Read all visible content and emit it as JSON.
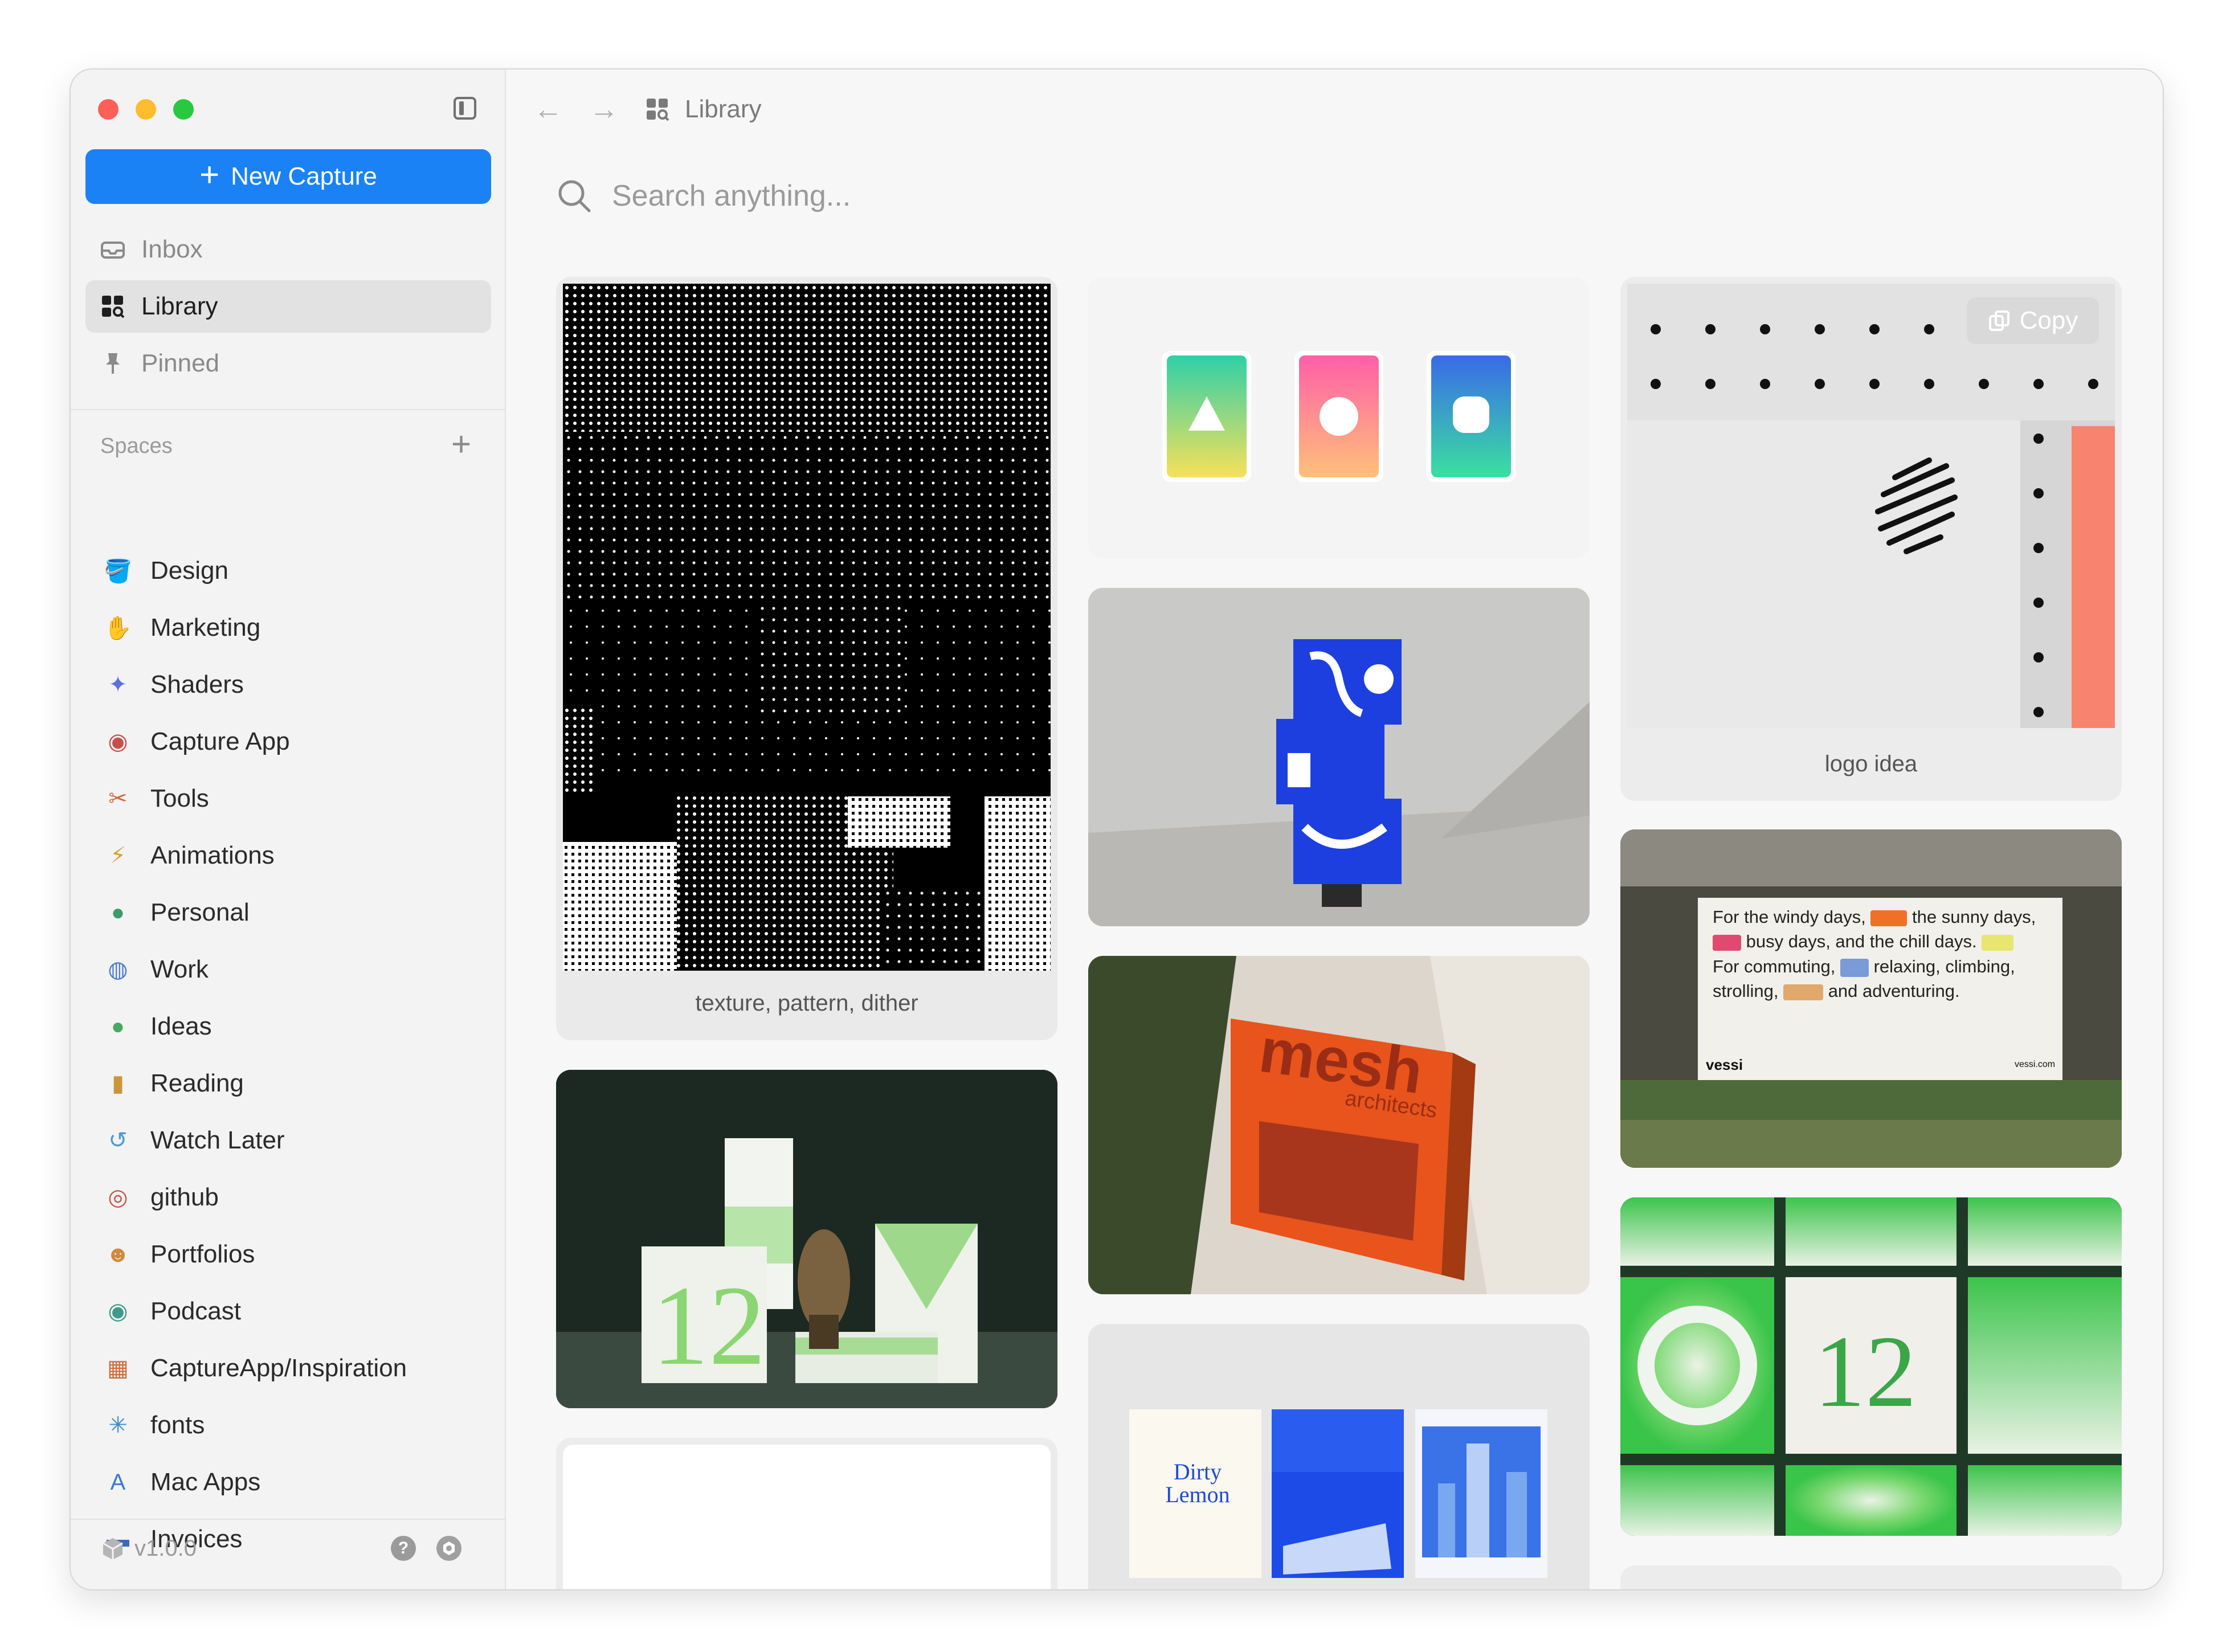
{
  "sidebar": {
    "new_capture_label": "New Capture",
    "nav": [
      {
        "label": "Inbox",
        "icon": "inbox-icon"
      },
      {
        "label": "Library",
        "icon": "library-icon",
        "active": true
      },
      {
        "label": "Pinned",
        "icon": "pin-icon"
      }
    ],
    "spaces_title": "Spaces",
    "spaces": [
      {
        "label": "Design",
        "icon": "paint-bucket-icon",
        "color": "#b05fc5"
      },
      {
        "label": "Marketing",
        "icon": "megaphone-icon",
        "color": "#e0607a"
      },
      {
        "label": "Shaders",
        "icon": "magic-wand-icon",
        "color": "#5a72d8"
      },
      {
        "label": "Capture App",
        "icon": "record-icon",
        "color": "#c8504a"
      },
      {
        "label": "Tools",
        "icon": "scissors-icon",
        "color": "#d06a3a"
      },
      {
        "label": "Animations",
        "icon": "bolt-icon",
        "color": "#d7a13a"
      },
      {
        "label": "Personal",
        "icon": "person-icon",
        "color": "#3e9a6a"
      },
      {
        "label": "Work",
        "icon": "globe-icon",
        "color": "#4a7ad0"
      },
      {
        "label": "Ideas",
        "icon": "lightbulb-icon",
        "color": "#4aa860"
      },
      {
        "label": "Reading",
        "icon": "book-icon",
        "color": "#c9963a"
      },
      {
        "label": "Watch Later",
        "icon": "history-icon",
        "color": "#4a9ad0"
      },
      {
        "label": "github",
        "icon": "github-icon",
        "color": "#c8504a"
      },
      {
        "label": "Portfolios",
        "icon": "smiley-icon",
        "color": "#d08a3a"
      },
      {
        "label": "Podcast",
        "icon": "podcast-icon",
        "color": "#3e9a8a"
      },
      {
        "label": "CaptureApp/Inspiration",
        "icon": "grid-icon",
        "color": "#d06a3a"
      },
      {
        "label": "fonts",
        "icon": "asterisk-icon",
        "color": "#3a8ad0"
      },
      {
        "label": "Mac Apps",
        "icon": "app-store-icon",
        "color": "#3a7ad0"
      },
      {
        "label": "Invoices",
        "icon": "archive-icon",
        "color": "#3a6ac0"
      }
    ],
    "version": "v1.0.0"
  },
  "topbar": {
    "breadcrumb": "Library"
  },
  "search": {
    "placeholder": "Search anything..."
  },
  "cards": {
    "texture_caption": "texture, pattern, dither",
    "logo_caption": "logo idea",
    "copy_label": "Copy",
    "mesh_title": "mesh",
    "mesh_sub": "architects",
    "billboard": {
      "line1a": "For the windy days,",
      "line1b": "the sunny days,",
      "line2": "busy days, and the chill days.",
      "line3a": "For commuting,",
      "line3b": "relaxing, climbing,",
      "line4a": "strolling,",
      "line4b": "and adventuring.",
      "brand": "vessi",
      "site": "vessi.com"
    },
    "matcha_number": "12",
    "poster_number": "12",
    "dirty_lemon": "Dirty Lemon"
  }
}
